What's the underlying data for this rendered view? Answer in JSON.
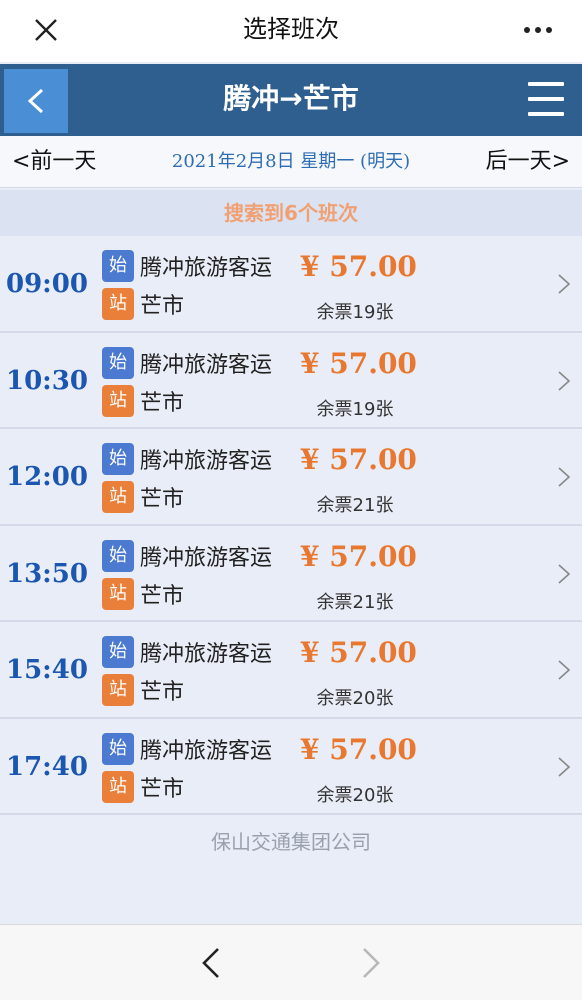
{
  "wechat": {
    "title": "选择班次",
    "close_icon": "close-icon",
    "more_icon": "more-icon"
  },
  "header": {
    "back_label": "<",
    "route_title": "腾冲→芒市",
    "menu_icon": "menu-icon"
  },
  "date_bar": {
    "prev_label": "<前一天",
    "date_text": "2021年2月8日 星期一 (明天)",
    "next_label": "后一天>"
  },
  "result": {
    "text": "搜索到6个班次"
  },
  "badges": {
    "start": "始",
    "end": "站"
  },
  "trips": [
    {
      "time": "09:00",
      "origin": "腾冲旅游客运",
      "destination": "芒市",
      "price": "¥ 57.00",
      "seats": "余票19张"
    },
    {
      "time": "10:30",
      "origin": "腾冲旅游客运",
      "destination": "芒市",
      "price": "¥ 57.00",
      "seats": "余票19张"
    },
    {
      "time": "12:00",
      "origin": "腾冲旅游客运",
      "destination": "芒市",
      "price": "¥ 57.00",
      "seats": "余票21张"
    },
    {
      "time": "13:50",
      "origin": "腾冲旅游客运",
      "destination": "芒市",
      "price": "¥ 57.00",
      "seats": "余票21张"
    },
    {
      "time": "15:40",
      "origin": "腾冲旅游客运",
      "destination": "芒市",
      "price": "¥ 57.00",
      "seats": "余票20张"
    },
    {
      "time": "17:40",
      "origin": "腾冲旅游客运",
      "destination": "芒市",
      "price": "¥ 57.00",
      "seats": "余票20张"
    }
  ],
  "footer": {
    "company": "保山交通集团公司"
  },
  "colors": {
    "header_bg": "#2f5f8f",
    "back_button_bg": "#4a8fd6",
    "time_blue": "#1b56b0",
    "price_orange": "#e8782f",
    "start_badge": "#4b7ad0",
    "end_badge": "#ea7f3a"
  }
}
